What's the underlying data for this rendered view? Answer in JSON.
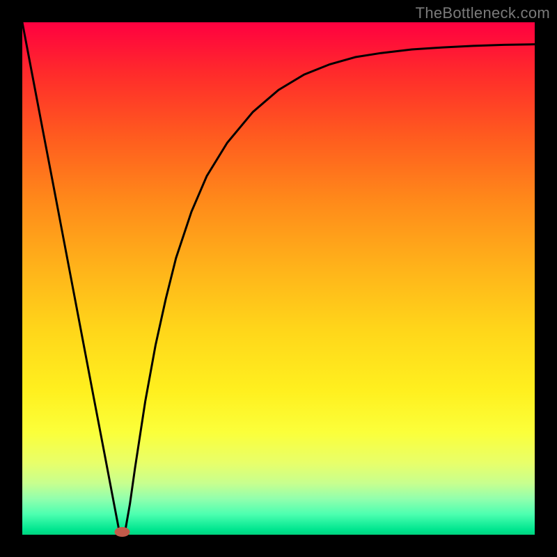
{
  "watermark": "TheBottleneck.com",
  "chart_data": {
    "type": "line",
    "title": "",
    "xlabel": "",
    "ylabel": "",
    "x": [
      0.0,
      0.02,
      0.04,
      0.06,
      0.08,
      0.1,
      0.12,
      0.14,
      0.16,
      0.18,
      0.19,
      0.2,
      0.21,
      0.22,
      0.24,
      0.26,
      0.28,
      0.3,
      0.33,
      0.36,
      0.4,
      0.45,
      0.5,
      0.55,
      0.6,
      0.65,
      0.7,
      0.76,
      0.82,
      0.88,
      0.94,
      1.0
    ],
    "values": [
      1.0,
      0.895,
      0.79,
      0.685,
      0.58,
      0.475,
      0.37,
      0.265,
      0.16,
      0.055,
      0.003,
      0.003,
      0.06,
      0.13,
      0.26,
      0.37,
      0.46,
      0.54,
      0.63,
      0.7,
      0.765,
      0.825,
      0.868,
      0.898,
      0.918,
      0.932,
      0.94,
      0.947,
      0.951,
      0.954,
      0.956,
      0.957
    ],
    "xlim": [
      0,
      1
    ],
    "ylim": [
      0,
      1
    ],
    "marker": {
      "x": 0.195,
      "y": 0.0
    },
    "background_gradient": [
      "#ff0040",
      "#ff5a1f",
      "#ffb31a",
      "#fff01f",
      "#c7ff8f",
      "#00d37f"
    ]
  }
}
